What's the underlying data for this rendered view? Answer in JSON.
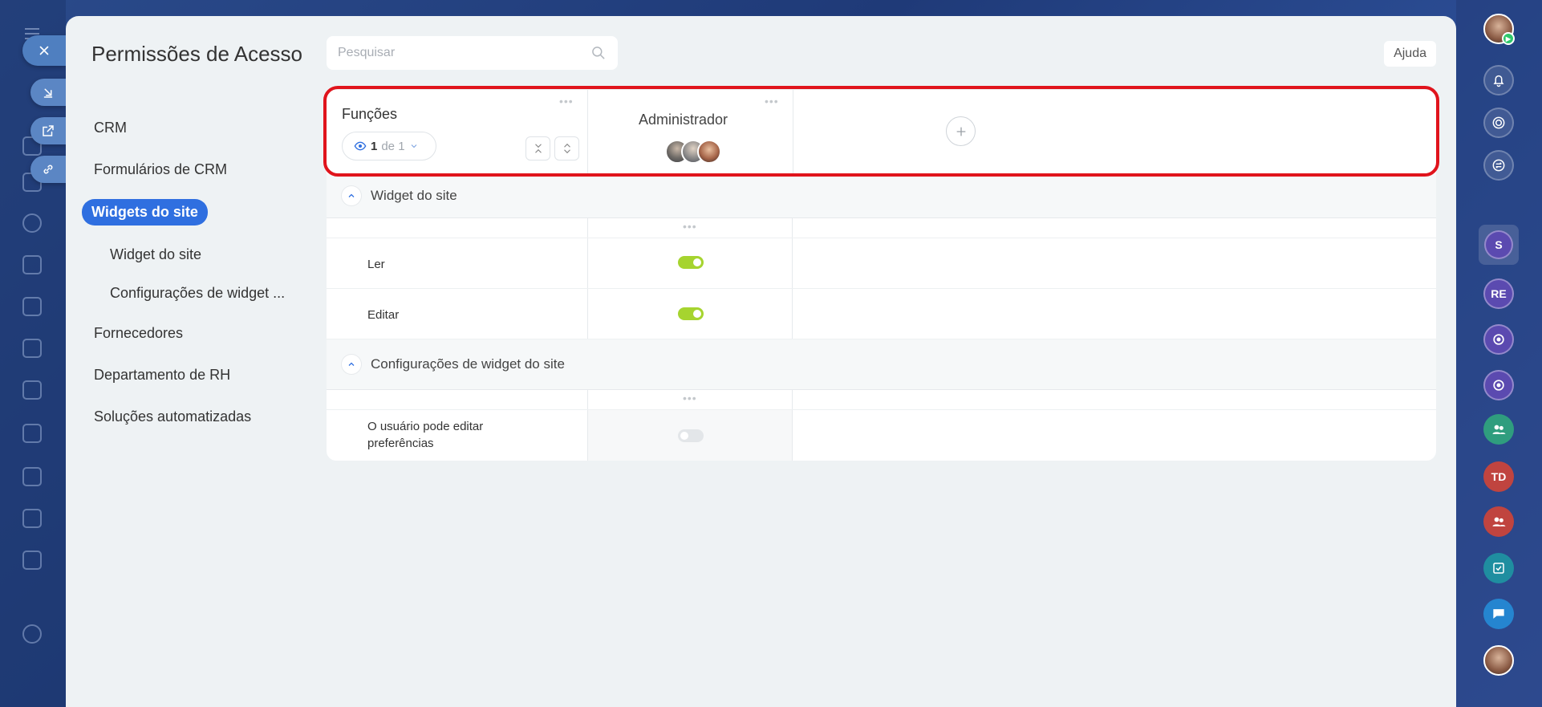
{
  "page_title": "Permissões de Acesso",
  "search": {
    "placeholder": "Pesquisar"
  },
  "help_label": "Ajuda",
  "nav": {
    "items": [
      {
        "label": "CRM"
      },
      {
        "label": "Formulários de CRM"
      },
      {
        "label": "Widgets do site",
        "active": true
      },
      {
        "label": "Widget do site",
        "sub": true
      },
      {
        "label": "Configurações de widget ...",
        "sub": true
      },
      {
        "label": "Fornecedores"
      },
      {
        "label": "Departamento de RH"
      },
      {
        "label": "Soluções automatizadas"
      }
    ]
  },
  "table": {
    "roles_header": "Funções",
    "dots": "•••",
    "viewer": {
      "count": "1",
      "of_text": "de 1"
    },
    "role_name": "Administrador",
    "sections": [
      {
        "title": "Widget do site",
        "permissions": [
          {
            "label": "Ler",
            "enabled": true
          },
          {
            "label": "Editar",
            "enabled": true
          }
        ]
      },
      {
        "title": "Configurações de widget do site",
        "permissions": [
          {
            "label": "O usuário pode editar preferências",
            "enabled": false
          }
        ]
      }
    ]
  },
  "right_bar": {
    "items": [
      {
        "icon": "user-avatar",
        "initials": ""
      },
      {
        "icon": "bell-icon"
      },
      {
        "icon": "target-icon"
      },
      {
        "icon": "swap-chat-icon"
      },
      {
        "initials": "S"
      },
      {
        "initials": "RE"
      },
      {
        "icon": "copilot-icon"
      },
      {
        "icon": "copilot-icon"
      },
      {
        "icon": "group-icon"
      },
      {
        "initials": "TD"
      },
      {
        "icon": "group-icon"
      },
      {
        "icon": "tasks-icon"
      },
      {
        "icon": "chat-icon"
      },
      {
        "icon": "user-avatar"
      }
    ]
  },
  "colors": {
    "accent": "#2f6fe0",
    "toggle_on": "#a6d42f",
    "highlight": "#e0141c"
  }
}
